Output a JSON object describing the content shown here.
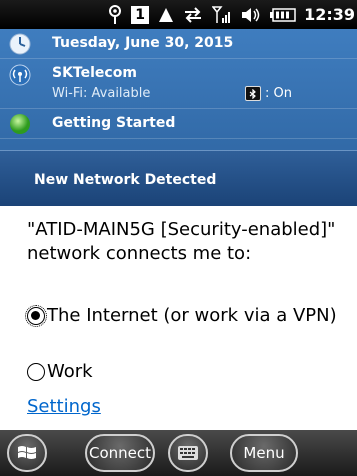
{
  "status_bar": {
    "time": "12:39",
    "icons": [
      "location-pin-icon",
      "notification-box-icon",
      "alert-triangle-icon",
      "data-sync-icon",
      "signal-strength-icon",
      "volume-icon",
      "battery-icon"
    ],
    "notification_glyph": "1"
  },
  "today": {
    "date": "Tuesday, June 30, 2015",
    "carrier": "SKTelecom",
    "wifi_status": "Wi-Fi: Available",
    "bluetooth_status": ": On",
    "getting_started": "Getting Started"
  },
  "dialog": {
    "title": "New Network Detected",
    "message": "\"ATID-MAIN5G [Security-enabled]\" network connects me to:",
    "options": [
      {
        "label": "The Internet (or work via a VPN)",
        "selected": true
      },
      {
        "label": "Work",
        "selected": false
      }
    ],
    "settings_link": "Settings"
  },
  "softkeys": {
    "left": "Connect",
    "right": "Menu"
  },
  "colors": {
    "today_background": "#2a5f9a",
    "dialog_title_bar": "#1b4377",
    "link": "#0066cc"
  }
}
